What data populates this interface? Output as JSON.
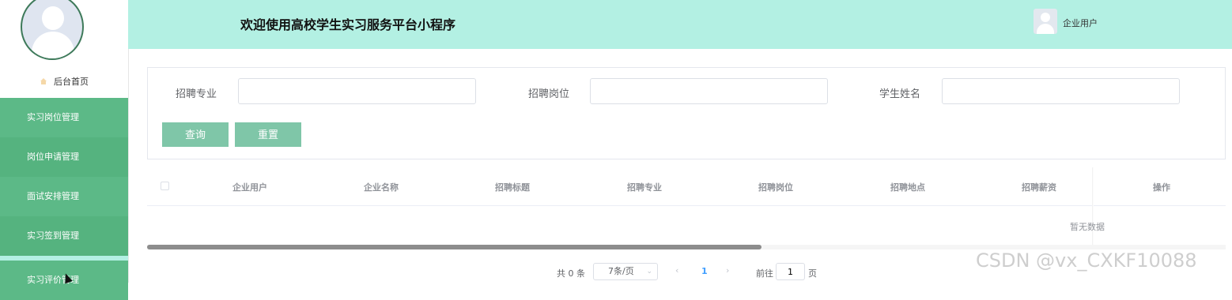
{
  "sidebar": {
    "home_label": "后台首页",
    "menu": [
      {
        "label": "实习岗位管理"
      },
      {
        "label": "岗位申请管理"
      },
      {
        "label": "面试安排管理"
      },
      {
        "label": "实习签到管理"
      },
      {
        "label": "实习评价管理"
      }
    ]
  },
  "header": {
    "title": "欢迎使用高校学生实习服务平台小程序",
    "user_label": "企业用户"
  },
  "search": {
    "fields": [
      {
        "label": "招聘专业",
        "value": ""
      },
      {
        "label": "招聘岗位",
        "value": ""
      },
      {
        "label": "学生姓名",
        "value": ""
      }
    ],
    "query_button": "查询",
    "reset_button": "重置"
  },
  "table": {
    "columns": [
      "企业用户",
      "企业名称",
      "招聘标题",
      "招聘专业",
      "招聘岗位",
      "招聘地点",
      "招聘薪资"
    ],
    "action_column": "操作",
    "empty_text": "暂无数据",
    "scroll_position": 0.57
  },
  "pagination": {
    "total_text": "共 0 条",
    "page_size": "7条/页",
    "current_page": "1",
    "goto_label": "前往",
    "goto_value": "1",
    "page_unit": "页"
  },
  "watermark": "CSDN @vx_CXKF10088",
  "colors": {
    "header_bg": "#b3f0e3",
    "menu_bg": "#5cb987",
    "button_bg": "#7fc6a8",
    "accent": "#409eff"
  },
  "icons": [
    "home-icon",
    "avatar-icon",
    "chevron-down-icon",
    "chevron-left-icon",
    "chevron-right-icon"
  ]
}
